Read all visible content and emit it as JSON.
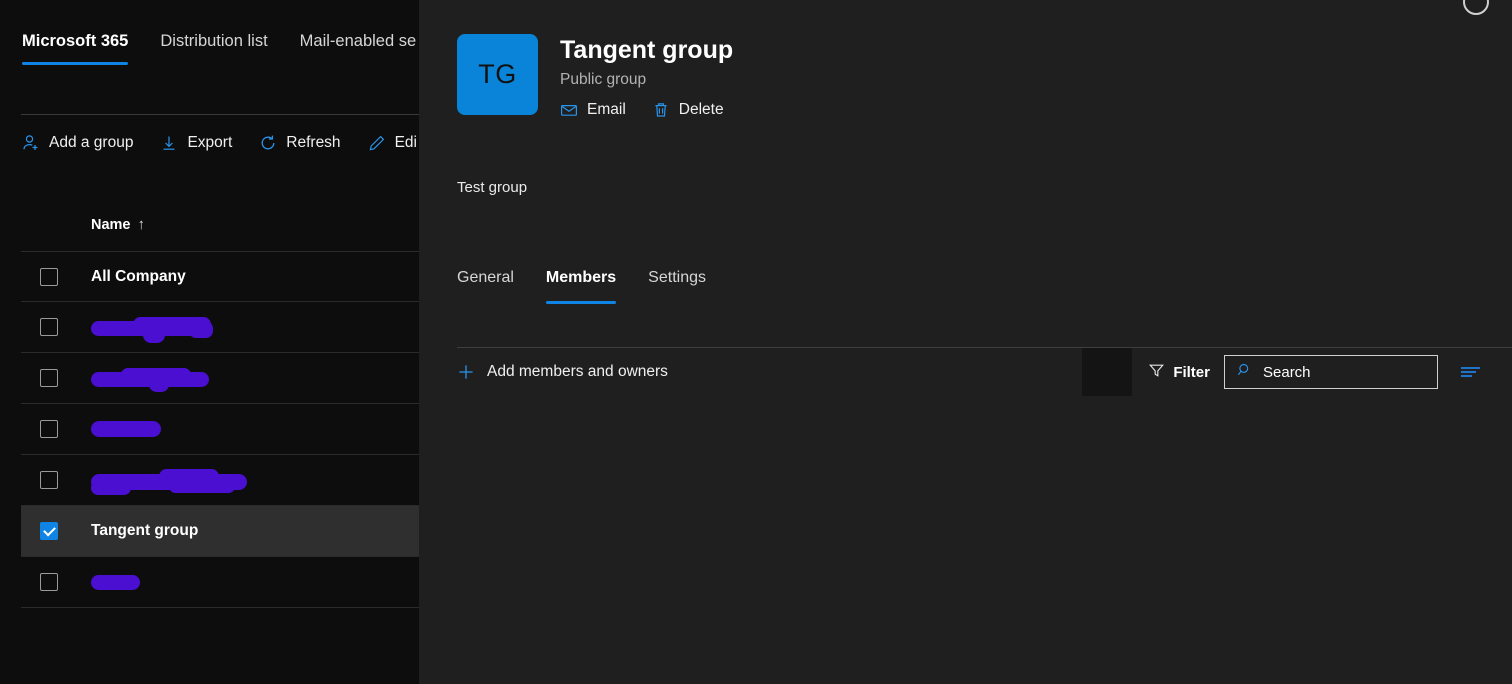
{
  "colors": {
    "accent": "#0f84e4",
    "avatar": "#0a84d8",
    "panel_bg": "#1f1f1f",
    "page_bg": "#0d0d0d",
    "redaction": "#4a0fd0",
    "selected_row": "#2f2f2f"
  },
  "groups_page": {
    "tabs": [
      {
        "label": "Microsoft 365",
        "active": true
      },
      {
        "label": "Distribution list",
        "active": false
      },
      {
        "label": "Mail-enabled se",
        "active": false
      }
    ],
    "commands": [
      {
        "label": "Add a group",
        "icon": "add-user-icon"
      },
      {
        "label": "Export",
        "icon": "download-icon"
      },
      {
        "label": "Refresh",
        "icon": "refresh-icon"
      },
      {
        "label": "Edi",
        "icon": "pencil-icon"
      }
    ],
    "column_header": {
      "label": "Name",
      "sort": "↑"
    },
    "rows": [
      {
        "name": "All Company",
        "redacted": false,
        "selected": false
      },
      {
        "name": "",
        "redacted": true,
        "selected": false,
        "redact_width": 120
      },
      {
        "name": "",
        "redacted": true,
        "selected": false,
        "redact_width": 118
      },
      {
        "name": "",
        "redacted": true,
        "selected": false,
        "redact_width": 68
      },
      {
        "name": "",
        "redacted": true,
        "selected": false,
        "redact_width": 155
      },
      {
        "name": "Tangent group",
        "redacted": false,
        "selected": true
      },
      {
        "name": "",
        "redacted": true,
        "selected": false,
        "redact_width": 48
      }
    ]
  },
  "panel": {
    "close_label": "Close",
    "avatar_initials": "TG",
    "title": "Tangent group",
    "subtitle": "Public group",
    "actions": [
      {
        "label": "Email",
        "icon": "mail-icon"
      },
      {
        "label": "Delete",
        "icon": "trash-icon"
      }
    ],
    "description": "Test group",
    "tabs": [
      {
        "label": "General",
        "active": false
      },
      {
        "label": "Members",
        "active": true
      },
      {
        "label": "Settings",
        "active": false
      }
    ],
    "toolbar": {
      "add_members_label": "Add members and owners",
      "filter_label": "Filter",
      "search_placeholder": "Search",
      "list_options_icon": "list-options-icon"
    }
  }
}
